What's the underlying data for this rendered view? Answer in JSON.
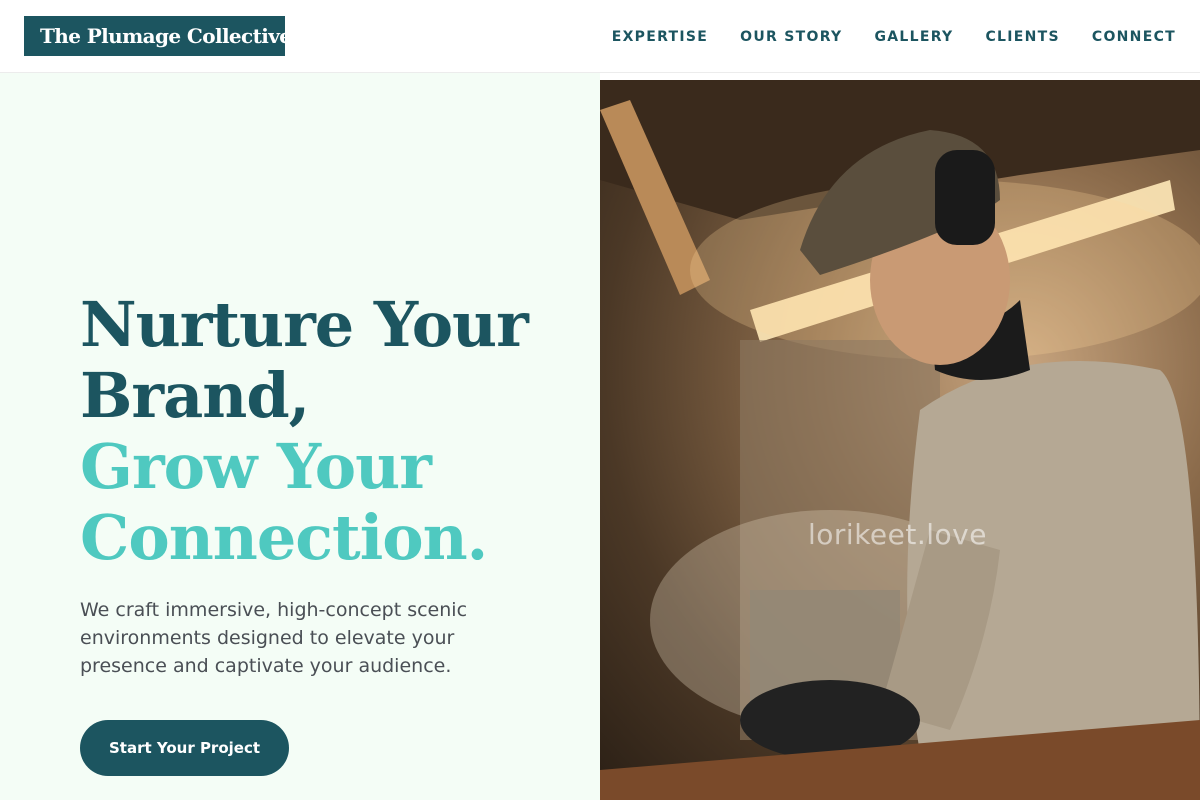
{
  "header": {
    "logo_text": "The Plumage Collective",
    "nav": [
      {
        "label": "EXPERTISE"
      },
      {
        "label": "OUR STORY"
      },
      {
        "label": "GALLERY"
      },
      {
        "label": "CLIENTS"
      },
      {
        "label": "CONNECT"
      }
    ]
  },
  "hero": {
    "headline_lines": [
      {
        "text": "Nurture Your",
        "style": "dark"
      },
      {
        "text": "Brand,",
        "style": "dark"
      },
      {
        "text": "Grow Your",
        "style": "accent"
      },
      {
        "text": "Connection.",
        "style": "accent"
      }
    ],
    "subtext": "We craft immersive, high-concept scenic environments designed to elevate your presence and captivate your audience.",
    "cta_label": "Start Your Project",
    "image_watermark": "lorikeet.love"
  },
  "colors": {
    "primary": "#1c5560",
    "accent": "#4fc9c0",
    "hero_background": "#f4fdf6",
    "body_text": "#4a4f55"
  }
}
